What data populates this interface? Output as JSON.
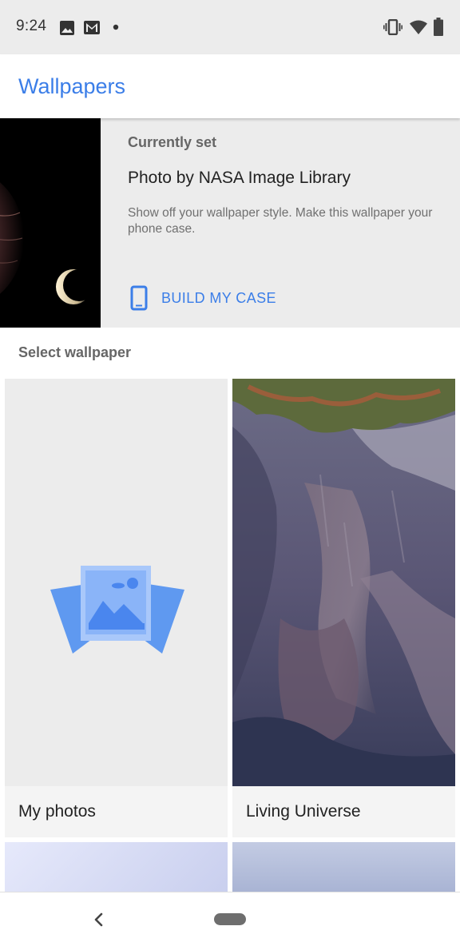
{
  "status_bar": {
    "time": "9:24",
    "left_icons": [
      "image-icon",
      "gmail-icon",
      "dot-icon"
    ],
    "right_icons": [
      "vibrate-icon",
      "wifi-icon",
      "battery-icon"
    ]
  },
  "app_bar": {
    "title": "Wallpapers"
  },
  "current": {
    "label": "Currently set",
    "title": "Photo by NASA Image Library",
    "description": "Show off your wallpaper style. Make this wallpaper your phone case.",
    "build_button_label": "BUILD MY CASE",
    "build_button_icon": "phone-icon"
  },
  "select": {
    "title": "Select wallpaper",
    "tiles": [
      {
        "label": "My photos",
        "icon": "photos-stack-icon"
      },
      {
        "label": "Living Universe"
      }
    ]
  },
  "nav_bar": {
    "icons": [
      "back-icon",
      "home-pill-icon"
    ]
  },
  "colors": {
    "accent": "#3b7ee8",
    "status_bar_bg": "#ececec",
    "section_bg": "#ececec"
  }
}
